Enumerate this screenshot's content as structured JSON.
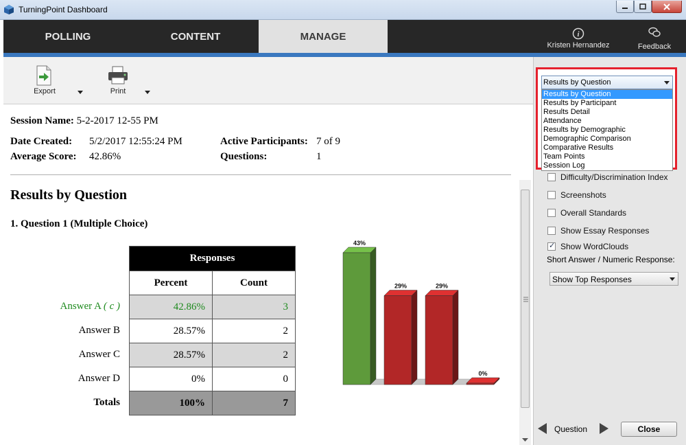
{
  "window": {
    "title": "TurningPoint Dashboard"
  },
  "nav": {
    "tabs": [
      {
        "label": "POLLING"
      },
      {
        "label": "CONTENT"
      },
      {
        "label": "MANAGE"
      }
    ],
    "user_name": "Kristen Hernandez",
    "feedback_label": "Feedback"
  },
  "toolbar": {
    "export_label": "Export",
    "print_label": "Print"
  },
  "session": {
    "name_label": "Session Name:",
    "name_value": "5-2-2017 12-55 PM",
    "date_label": "Date Created:",
    "date_value": "5/2/2017 12:55:24 PM",
    "avg_label": "Average Score:",
    "avg_value": "42.86%",
    "active_label": "Active Participants:",
    "active_value": "7 of 9",
    "questions_label": "Questions:",
    "questions_value": "1"
  },
  "report": {
    "title": "Results by Question",
    "question_title": "1. Question 1 (Multiple Choice)",
    "table_header": "Responses",
    "col_percent": "Percent",
    "col_count": "Count",
    "rows": [
      {
        "answer": "Answer A",
        "answer_suffix": "( c )",
        "percent": "42.86%",
        "count": "3",
        "correct": true
      },
      {
        "answer": "Answer B",
        "answer_suffix": "",
        "percent": "28.57%",
        "count": "2",
        "correct": false
      },
      {
        "answer": "Answer C",
        "answer_suffix": "",
        "percent": "28.57%",
        "count": "2",
        "correct": false
      },
      {
        "answer": "Answer D",
        "answer_suffix": "",
        "percent": "0%",
        "count": "0",
        "correct": false
      }
    ],
    "totals": {
      "label": "Totals",
      "percent": "100%",
      "count": "7"
    }
  },
  "chart_data": {
    "type": "bar",
    "categories": [
      "Answer A",
      "Answer B",
      "Answer C",
      "Answer D"
    ],
    "values": [
      43,
      29,
      29,
      0
    ],
    "value_labels": [
      "43%",
      "29%",
      "29%",
      "0%"
    ],
    "bar_colors": [
      "#5e9a3b",
      "#b22727",
      "#b22727",
      "#b22727"
    ],
    "ylim": [
      0,
      43
    ]
  },
  "right_panel": {
    "report_select": "Results by Question",
    "report_options": [
      "Results by Question",
      "Results by Participant",
      "Results Detail",
      "Attendance",
      "Results by Demographic",
      "Demographic Comparison",
      "Comparative Results",
      "Team Points",
      "Session Log"
    ],
    "options": [
      {
        "label": "Difficulty/Discrimination Index",
        "checked": false
      },
      {
        "label": "Screenshots",
        "checked": false
      },
      {
        "label": "Overall Standards",
        "checked": false
      },
      {
        "label": "Show Essay Responses",
        "checked": false
      },
      {
        "label": "Show WordClouds",
        "checked": true
      }
    ],
    "short_answer_label": "Short Answer / Numeric Response:",
    "short_answer_select": "Show Top Responses",
    "nav_label": "Question",
    "close_label": "Close"
  },
  "colors": {
    "accent_blue": "#3a78bf",
    "correct_green": "#1e8a1e",
    "highlight_red": "#e5202c"
  }
}
